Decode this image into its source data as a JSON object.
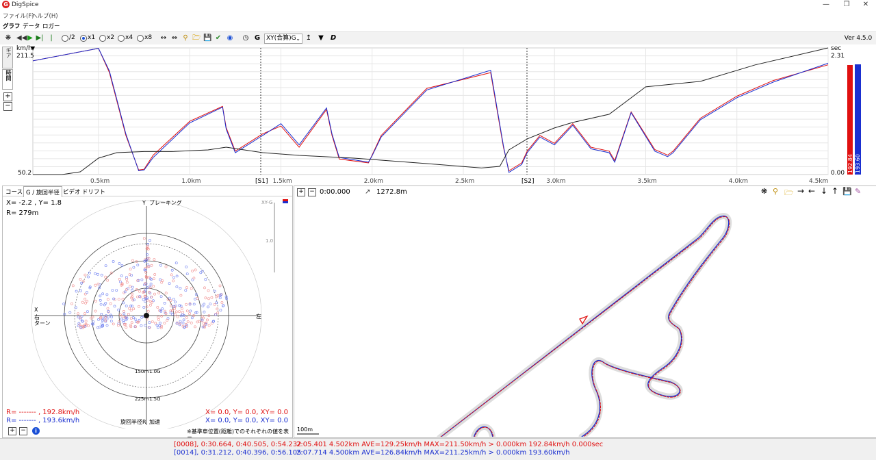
{
  "app": {
    "title": "DigSpice",
    "version": "Ver 4.5.0"
  },
  "menu": [
    "ファイル(F)",
    "ヘルプ(H)"
  ],
  "tabs": [
    "グラフ",
    "データ",
    "ロガー"
  ],
  "toolbar": {
    "speeds": [
      {
        "label": "/2",
        "checked": false
      },
      {
        "label": "x1",
        "checked": true
      },
      {
        "label": "x2",
        "checked": false
      },
      {
        "label": "x4",
        "checked": false
      },
      {
        "label": "x8",
        "checked": false
      }
    ],
    "graph_type": "XY(合算)G",
    "g_icon": "G"
  },
  "graph": {
    "left_unit": "km/h",
    "left_max": "211.5",
    "left_min": "50.2",
    "right_unit": "sec",
    "right_max": "2.31",
    "right_min": "0.00",
    "side_tabs": [
      "ギア",
      "時間"
    ],
    "x_ticks": [
      "0.5km",
      "1.0km",
      "1.5km",
      "2.0km",
      "2.5km",
      "3.0km",
      "3.5km",
      "4.0km",
      "4.5km"
    ],
    "sectors": [
      "[S1]",
      "[S2]"
    ],
    "bar_red_value": "192.84",
    "bar_blue_value": "193.60"
  },
  "chart_data": {
    "type": "line",
    "xlabel": "",
    "ylabel": "km/h",
    "xlim": [
      0.14,
      4.5
    ],
    "ylim": [
      50.2,
      211.5
    ],
    "y2lim": [
      0.0,
      2.31
    ],
    "series": [
      {
        "color": "#e01010",
        "axis": "left",
        "x": [
          0.14,
          0.5,
          0.56,
          0.65,
          0.72,
          0.75,
          0.8,
          1.0,
          1.18,
          1.2,
          1.25,
          1.4,
          1.5,
          1.6,
          1.75,
          1.78,
          1.82,
          1.98,
          2.0,
          2.05,
          2.3,
          2.65,
          2.72,
          2.75,
          2.82,
          2.85,
          2.92,
          3.0,
          3.1,
          3.2,
          3.3,
          3.33,
          3.42,
          3.55,
          3.62,
          3.65,
          3.8,
          4.0,
          4.2,
          4.5
        ],
        "y": [
          195,
          211,
          180,
          100,
          56,
          57,
          75,
          118,
          137,
          110,
          80,
          102,
          112,
          85,
          133,
          100,
          70,
          65,
          75,
          100,
          160,
          180,
          85,
          55,
          65,
          80,
          100,
          90,
          115,
          85,
          80,
          68,
          130,
          82,
          75,
          80,
          122,
          150,
          170,
          190
        ]
      },
      {
        "color": "#1a2fd0",
        "axis": "left",
        "x": [
          0.14,
          0.5,
          0.56,
          0.65,
          0.72,
          0.75,
          0.8,
          1.0,
          1.18,
          1.2,
          1.25,
          1.4,
          1.5,
          1.6,
          1.75,
          1.78,
          1.82,
          1.98,
          2.0,
          2.05,
          2.3,
          2.65,
          2.72,
          2.75,
          2.82,
          2.85,
          2.92,
          3.0,
          3.1,
          3.2,
          3.3,
          3.33,
          3.42,
          3.55,
          3.62,
          3.65,
          3.8,
          4.0,
          4.2,
          4.5
        ],
        "y": [
          195,
          211,
          182,
          102,
          55,
          56,
          72,
          116,
          136,
          108,
          78,
          100,
          115,
          88,
          135,
          102,
          72,
          66,
          74,
          98,
          158,
          183,
          87,
          53,
          63,
          78,
          98,
          88,
          113,
          83,
          78,
          66,
          129,
          80,
          73,
          78,
          120,
          148,
          168,
          192
        ]
      },
      {
        "color": "#222222",
        "axis": "right",
        "x": [
          0.14,
          0.3,
          0.4,
          0.5,
          0.6,
          0.75,
          0.9,
          1.1,
          1.2,
          1.4,
          1.6,
          1.9,
          2.3,
          2.6,
          2.7,
          2.75,
          2.85,
          3.0,
          3.1,
          3.3,
          3.5,
          3.8,
          4.1,
          4.5
        ],
        "y": [
          0.0,
          0.0,
          0.05,
          0.3,
          0.4,
          0.42,
          0.42,
          0.45,
          0.5,
          0.4,
          0.35,
          0.3,
          0.2,
          0.12,
          0.15,
          0.45,
          0.65,
          0.85,
          0.95,
          1.1,
          1.6,
          1.7,
          2.0,
          2.31
        ]
      }
    ]
  },
  "gpanel": {
    "tabs": [
      "コース",
      "G / 旋回半径",
      "ビデオ",
      "ドリフト"
    ],
    "readout_xy": "X= -2.2 , Y=  1.8",
    "readout_r": "R= 279m",
    "label_y": "Y",
    "label_brake": "ブレーキング",
    "label_x": "X",
    "label_right": "右",
    "label_turn": "ターン",
    "label_left": "左",
    "label_150": "150m",
    "label_10g": "1.0G",
    "label_225": "225m",
    "label_15g": "1.5G",
    "label_radius": "旋回半径R",
    "label_accel": "加速",
    "xyg_label": "XY-G",
    "scale_10": "1.0",
    "red_r": "R= -------  , 192.8km/h",
    "blue_r": "R= -------  , 193.6km/h",
    "red_xy": "X=  0.0, Y=  0.0, XY= 0.0",
    "blue_xy": "X=  0.0, Y=  0.0, XY= 0.0",
    "note": "※基準車位置(距離)でのそれぞれの値を表示"
  },
  "map": {
    "time": "0:00.000",
    "distance": "1272.8m",
    "scale": "100m"
  },
  "bottom": {
    "red_laps": "[0008], 0:30.664, 0:40.505, 0:54.232",
    "blue_laps": "[0014], 0:31.212, 0:40.396, 0:56.105",
    "red_summary": "2:05.401 4.502km AVE=129.25km/h MAX=211.50km/h > 0.000km 192.84km/h 0.000sec",
    "blue_summary": "2:07.714 4.500km AVE=126.84km/h MAX=211.25km/h > 0.000km 193.60km/h"
  },
  "colors": {
    "red": "#e01010",
    "blue": "#1a2fd0"
  }
}
